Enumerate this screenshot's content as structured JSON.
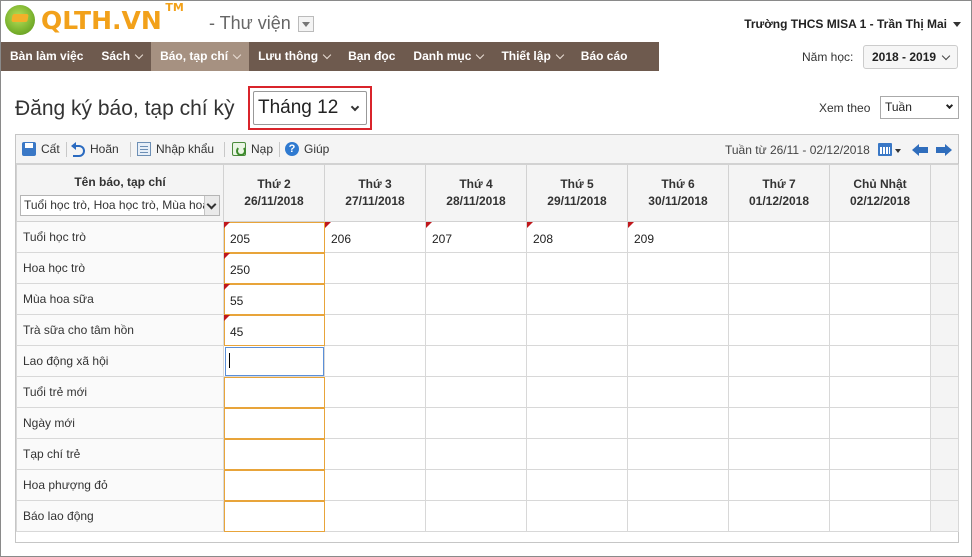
{
  "header": {
    "logo_text": "QLTH.VN",
    "logo_tm": "TM",
    "module": "- Thư viện",
    "user": "Trường THCS MISA 1 - Trần Thị Mai"
  },
  "nav": {
    "items": [
      {
        "label": "Bàn làm việc"
      },
      {
        "label": "Sách"
      },
      {
        "label": "Báo, tạp chí"
      },
      {
        "label": "Lưu thông"
      },
      {
        "label": "Bạn đọc"
      },
      {
        "label": "Danh mục"
      },
      {
        "label": "Thiết lập"
      },
      {
        "label": "Báo cáo"
      }
    ],
    "year_label": "Năm học:",
    "year_value": "2018 - 2019"
  },
  "page": {
    "title": "Đăng ký báo, tạp chí kỳ",
    "month_value": "Tháng 12",
    "view_label": "Xem theo",
    "view_value": "Tuần"
  },
  "toolbar": {
    "cut": "Cất",
    "undo": "Hoãn",
    "import": "Nhập khẩu",
    "reload": "Nạp",
    "help": "Giúp",
    "help_glyph": "?",
    "week_range": "Tuần từ 26/11 - 02/12/2018"
  },
  "table": {
    "name_header": "Tên báo, tạp chí",
    "filter_value": "Tuổi học trò, Hoa học trò, Mùa hoa",
    "days": [
      {
        "day": "Thứ 2",
        "date": "26/11/2018"
      },
      {
        "day": "Thứ 3",
        "date": "27/11/2018"
      },
      {
        "day": "Thứ 4",
        "date": "28/11/2018"
      },
      {
        "day": "Thứ 5",
        "date": "29/11/2018"
      },
      {
        "day": "Thứ 6",
        "date": "30/11/2018"
      },
      {
        "day": "Thứ 7",
        "date": "01/12/2018"
      },
      {
        "day": "Chủ Nhật",
        "date": "02/12/2018"
      }
    ],
    "rows": [
      {
        "name": "Tuổi học trò",
        "values": [
          "205",
          "206",
          "207",
          "208",
          "209",
          "",
          ""
        ]
      },
      {
        "name": "Hoa học trò",
        "values": [
          "250",
          "",
          "",
          "",
          "",
          "",
          ""
        ]
      },
      {
        "name": "Mùa hoa sữa",
        "values": [
          "55",
          "",
          "",
          "",
          "",
          "",
          ""
        ]
      },
      {
        "name": "Trà sữa cho tâm hồn",
        "values": [
          "45",
          "",
          "",
          "",
          "",
          "",
          ""
        ]
      },
      {
        "name": "Lao động xã hội",
        "values": [
          "",
          "",
          "",
          "",
          "",
          "",
          ""
        ]
      },
      {
        "name": "Tuổi trẻ mới",
        "values": [
          "",
          "",
          "",
          "",
          "",
          "",
          ""
        ]
      },
      {
        "name": "Ngày mới",
        "values": [
          "",
          "",
          "",
          "",
          "",
          "",
          ""
        ]
      },
      {
        "name": "Tạp chí trẻ",
        "values": [
          "",
          "",
          "",
          "",
          "",
          "",
          ""
        ]
      },
      {
        "name": "Hoa phượng đỏ",
        "values": [
          "",
          "",
          "",
          "",
          "",
          "",
          ""
        ]
      },
      {
        "name": "Báo lao động",
        "values": [
          "",
          "",
          "",
          "",
          "",
          "",
          ""
        ]
      }
    ]
  }
}
